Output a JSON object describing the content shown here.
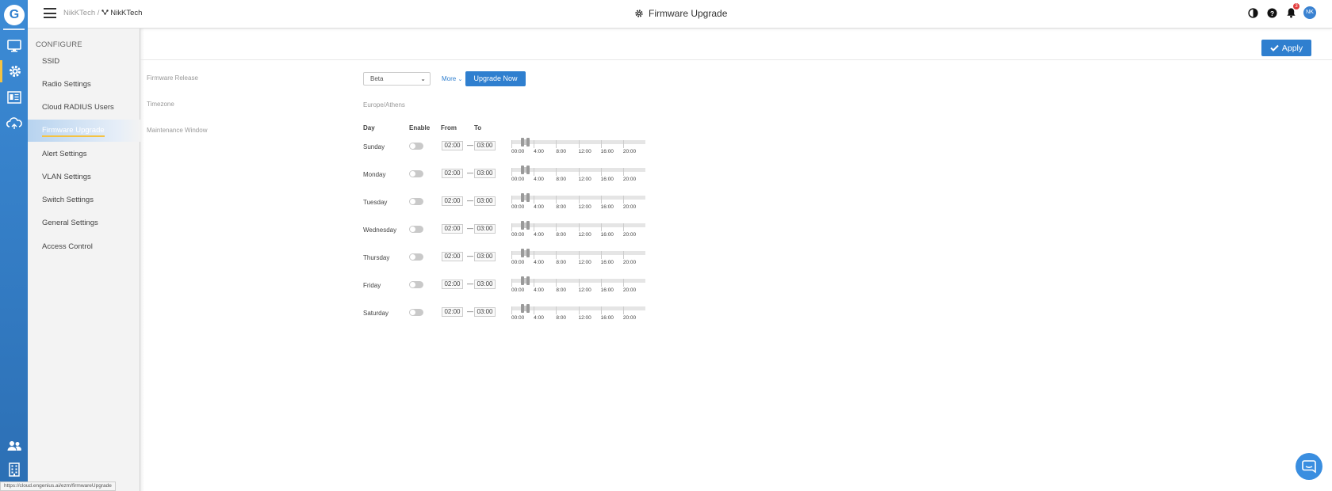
{
  "topbar": {
    "breadcrumb_org": "NikKTech",
    "breadcrumb_sep": "/",
    "breadcrumb_site": "NikKTech",
    "page_title": "Firmware Upgrade",
    "notification_count": "3",
    "avatar_initials": "NK",
    "site_icon": "network-icon",
    "title_icon": "gear-icon"
  },
  "rail": {
    "logo": "G",
    "items": [
      "monitor-icon",
      "gear-icon",
      "report-icon",
      "cloud-icon",
      "users-icon",
      "building-icon"
    ],
    "accent": "#f5c342"
  },
  "submenu": {
    "section": "CONFIGURE",
    "items": [
      {
        "label": "SSID"
      },
      {
        "label": "Radio Settings"
      },
      {
        "label": "Cloud RADIUS Users"
      },
      {
        "label": "Firmware Upgrade",
        "active": true
      },
      {
        "label": "Alert Settings"
      },
      {
        "label": "VLAN Settings"
      },
      {
        "label": "Switch Settings"
      },
      {
        "label": "General Settings"
      },
      {
        "label": "Access Control"
      }
    ]
  },
  "actions": {
    "apply_label": "Apply"
  },
  "form": {
    "firmware_release_label": "Firmware Release",
    "firmware_release_value": "Beta",
    "more_label": "More",
    "upgrade_now_label": "Upgrade Now",
    "timezone_label": "Timezone",
    "timezone_value": "Europe/Athens",
    "maintenance_label": "Maintenance Window"
  },
  "schedule": {
    "headers": {
      "day": "Day",
      "enable": "Enable",
      "from": "From",
      "to": "To"
    },
    "separator": "—",
    "hour_labels": [
      "00:00",
      "4:00",
      "8:00",
      "12:00",
      "16:00",
      "20:00"
    ],
    "days": [
      {
        "day": "Sunday",
        "enabled": false,
        "from": "02:00",
        "to": "03:00"
      },
      {
        "day": "Monday",
        "enabled": false,
        "from": "02:00",
        "to": "03:00"
      },
      {
        "day": "Tuesday",
        "enabled": false,
        "from": "02:00",
        "to": "03:00"
      },
      {
        "day": "Wednesday",
        "enabled": false,
        "from": "02:00",
        "to": "03:00"
      },
      {
        "day": "Thursday",
        "enabled": false,
        "from": "02:00",
        "to": "03:00"
      },
      {
        "day": "Friday",
        "enabled": false,
        "from": "02:00",
        "to": "03:00"
      },
      {
        "day": "Saturday",
        "enabled": false,
        "from": "02:00",
        "to": "03:00"
      }
    ]
  },
  "status_url": "https://cloud.engenius.ai/ezm/firmwareUpgrade",
  "colors": {
    "primary": "#2f7fcf",
    "rail": "#2f7fcf",
    "badge": "#e23c3c"
  }
}
